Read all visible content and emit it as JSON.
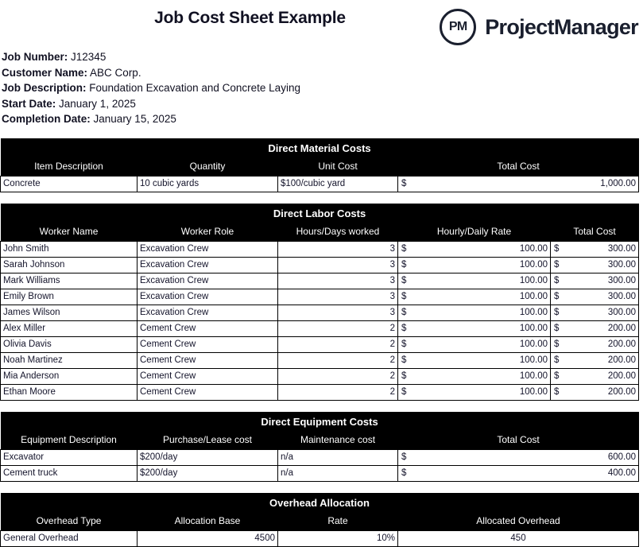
{
  "document": {
    "title": "Job Cost Sheet Example"
  },
  "brand": {
    "mark_text": "PM",
    "name": "ProjectManager"
  },
  "meta": [
    {
      "label": "Job Number:",
      "value": "J12345"
    },
    {
      "label": "Customer Name:",
      "value": "ABC Corp."
    },
    {
      "label": "Job Description:",
      "value": "Foundation Excavation and Concrete Laying"
    },
    {
      "label": "Start Date:",
      "value": "January 1, 2025"
    },
    {
      "label": "Completion Date:",
      "value": "January 15, 2025"
    }
  ],
  "sections": {
    "material": {
      "title": "Direct Material Costs",
      "columns": [
        "Item Description",
        "Quantity",
        "Unit Cost",
        "Total Cost"
      ],
      "rows": [
        {
          "item": "Concrete",
          "quantity": "10 cubic yards",
          "unit_cost": "$100/cubic yard",
          "total_cost": "1,000.00"
        }
      ]
    },
    "labor": {
      "title": "Direct Labor Costs",
      "columns": [
        "Worker Name",
        "Worker Role",
        "Hours/Days worked",
        "Hourly/Daily Rate",
        "Total Cost"
      ],
      "rows": [
        {
          "name": "John Smith",
          "role": "Excavation Crew",
          "hours": "3",
          "rate": "100.00",
          "total": "300.00"
        },
        {
          "name": "Sarah Johnson",
          "role": "Excavation Crew",
          "hours": "3",
          "rate": "100.00",
          "total": "300.00"
        },
        {
          "name": "Mark Williams",
          "role": "Excavation Crew",
          "hours": "3",
          "rate": "100.00",
          "total": "300.00"
        },
        {
          "name": "Emily Brown",
          "role": "Excavation Crew",
          "hours": "3",
          "rate": "100.00",
          "total": "300.00"
        },
        {
          "name": "James Wilson",
          "role": "Excavation Crew",
          "hours": "3",
          "rate": "100.00",
          "total": "300.00"
        },
        {
          "name": "Alex Miller",
          "role": "Cement Crew",
          "hours": "2",
          "rate": "100.00",
          "total": "200.00"
        },
        {
          "name": "Olivia Davis",
          "role": "Cement Crew",
          "hours": "2",
          "rate": "100.00",
          "total": "200.00"
        },
        {
          "name": "Noah Martinez",
          "role": "Cement Crew",
          "hours": "2",
          "rate": "100.00",
          "total": "200.00"
        },
        {
          "name": "Mia Anderson",
          "role": "Cement Crew",
          "hours": "2",
          "rate": "100.00",
          "total": "200.00"
        },
        {
          "name": "Ethan Moore",
          "role": "Cement Crew",
          "hours": "2",
          "rate": "100.00",
          "total": "200.00"
        }
      ]
    },
    "equipment": {
      "title": "Direct Equipment Costs",
      "columns": [
        "Equipment Description",
        "Purchase/Lease cost",
        "Maintenance cost",
        "Total Cost"
      ],
      "rows": [
        {
          "description": "Excavator",
          "lease": "$200/day",
          "maintenance": "n/a",
          "total": "600.00"
        },
        {
          "description": "Cement truck",
          "lease": "$200/day",
          "maintenance": "n/a",
          "total": "400.00"
        }
      ]
    },
    "overhead": {
      "title": "Overhead Allocation",
      "columns": [
        "Overhead Type",
        "Allocation Base",
        "Rate",
        "Allocated Overhead"
      ],
      "rows": [
        {
          "type": "General Overhead",
          "base": "4500",
          "rate": "10%",
          "allocated": "450"
        }
      ]
    }
  }
}
